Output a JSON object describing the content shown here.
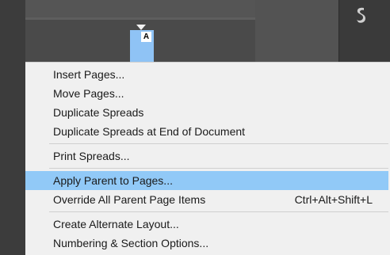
{
  "pages_panel": {
    "parent_label": "A",
    "dock_icon": "script-s-icon"
  },
  "context_menu": {
    "groups": [
      [
        {
          "label": "Insert Pages..."
        },
        {
          "label": "Move Pages..."
        },
        {
          "label": "Duplicate Spreads"
        },
        {
          "label": "Duplicate Spreads at End of Document"
        }
      ],
      [
        {
          "label": "Print Spreads..."
        }
      ],
      [
        {
          "label": "Apply Parent to Pages...",
          "highlighted": true
        },
        {
          "label": "Override All Parent Page Items",
          "shortcut": "Ctrl+Alt+Shift+L"
        }
      ],
      [
        {
          "label": "Create Alternate Layout..."
        },
        {
          "label": "Numbering & Section Options..."
        }
      ]
    ]
  },
  "colors": {
    "highlight": "#91c9f7",
    "menu_bg": "#f0f0f0",
    "page_thumb": "#8fc3f5"
  }
}
